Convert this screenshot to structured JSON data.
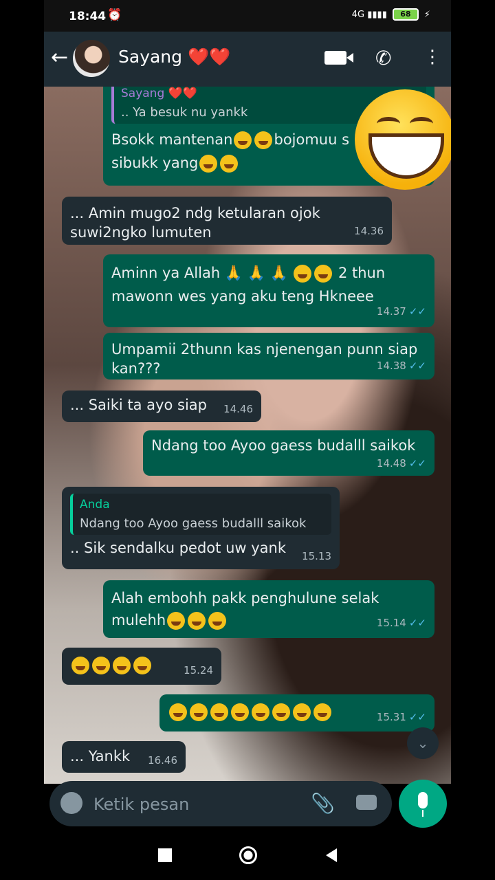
{
  "status": {
    "time": "18:44",
    "battery": "68",
    "signal": "4G"
  },
  "header": {
    "back_icon": "arrow-back-icon",
    "contact_name": "Sayang",
    "hearts": "❤️❤️"
  },
  "messages": [
    {
      "id": 1,
      "dir": "out",
      "quote_name": "Sayang ❤️❤️",
      "quote_text": ".. Ya besuk nu yankk",
      "text_a": "Bsokk mantenan",
      "text_b": "bojomuu s",
      "text_c": "sibukk yang",
      "time": ""
    },
    {
      "id": 2,
      "dir": "in",
      "text": "... Amin mugo2 ndg ketularan ojok suwi2ngko lumuten",
      "time": "14.36"
    },
    {
      "id": 3,
      "dir": "out",
      "text_a": "Aminn ya Allah 🙏 🙏 🙏",
      "text_b": " 2 thun mawonn wes yang aku teng Hkneee",
      "time": "14.37"
    },
    {
      "id": 4,
      "dir": "out",
      "text": "Umpamii 2thunn kas njenengan punn siap kan???",
      "time": "14.38"
    },
    {
      "id": 5,
      "dir": "in",
      "text": "... Saiki ta ayo siap",
      "time": "14.46"
    },
    {
      "id": 6,
      "dir": "out",
      "text": "Ndang too Ayoo gaess budalll saikok",
      "time": "14.48"
    },
    {
      "id": 7,
      "dir": "in",
      "quote_name": "Anda",
      "quote_text": "Ndang too Ayoo gaess budalll saikok",
      "text": ".. Sik sendalku pedot uw yank",
      "time": "15.13"
    },
    {
      "id": 8,
      "dir": "out",
      "text_a": "Alah embohh pakk penghulune selak mulehh",
      "time": "15.14"
    },
    {
      "id": 9,
      "dir": "in",
      "time": "15.24"
    },
    {
      "id": 10,
      "dir": "out",
      "time": "15.31"
    },
    {
      "id": 11,
      "dir": "in",
      "text": "... Yankk",
      "time": "16.46"
    }
  ],
  "composer": {
    "placeholder": "Ketik pesan"
  }
}
